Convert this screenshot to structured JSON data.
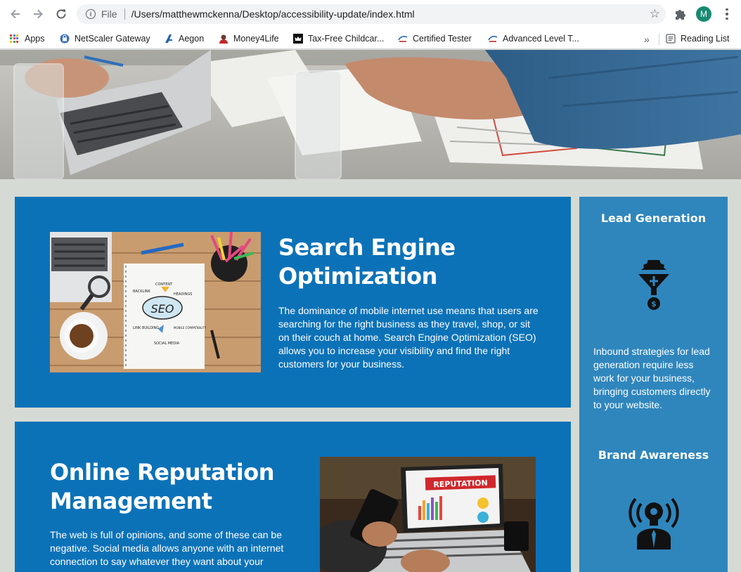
{
  "browser": {
    "url_scheme": "File",
    "url_path": "/Users/matthewmckenna/Desktop/accessibility-update/index.html",
    "profile_initial": "M",
    "accent_color": "#188a72"
  },
  "bookmarks": {
    "items": [
      {
        "label": "Apps",
        "icon": "apps-grid-icon"
      },
      {
        "label": "NetScaler Gateway",
        "icon": "netscaler-icon"
      },
      {
        "label": "Aegon",
        "icon": "aegon-icon"
      },
      {
        "label": "Money4Life",
        "icon": "money4life-icon"
      },
      {
        "label": "Tax-Free Childcar...",
        "icon": "crown-icon"
      },
      {
        "label": "Certified Tester",
        "icon": "istqb-icon"
      },
      {
        "label": "Advanced Level T...",
        "icon": "istqb-icon"
      }
    ],
    "overflow": "»",
    "reading_list": "Reading List"
  },
  "main": {
    "sections": [
      {
        "title": "Search Engine Optimization",
        "body": "The dominance of mobile internet use means that users are searching for the right business as they travel, shop, or sit on their couch at home. Search Engine Optimization (SEO) allows you to increase your visibility and find the right customers for your business.",
        "image_words": [
          "CONTENT",
          "BACKLINK",
          "HEADINGS",
          "SEO",
          "LINK BUILDING",
          "MOBILE COMPATIBILITY",
          "SOCIAL MEDIA"
        ]
      },
      {
        "title": "Online Reputation Management",
        "body": "The web is full of opinions, and some of these can be negative. Social media allows anyone with an internet connection to say whatever they want about your",
        "image_words": [
          "REPUTATION"
        ]
      }
    ]
  },
  "aside": {
    "items": [
      {
        "title": "Lead Generation",
        "icon": "lead-generation-funnel-icon",
        "body": "Inbound strategies for lead generation require less work for your business, bringing customers directly to your website."
      },
      {
        "title": "Brand Awareness",
        "icon": "brand-awareness-lightbulb-icon"
      }
    ]
  },
  "colors": {
    "card_blue": "#0c72b8",
    "aside_blue": "#2f86bd",
    "page_background": "#d6dad4"
  }
}
